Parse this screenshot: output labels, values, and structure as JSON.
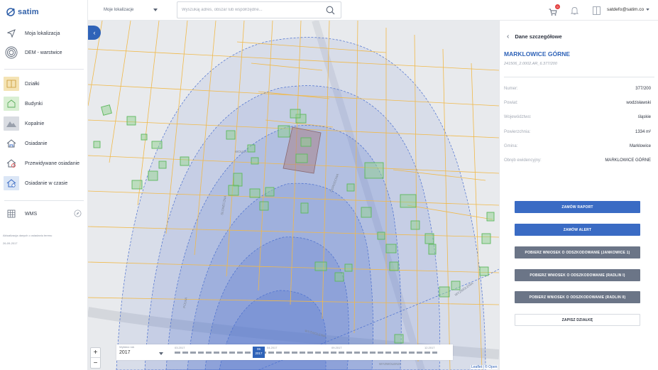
{
  "app": {
    "logo_text": "satim"
  },
  "sidebar": {
    "items": [
      {
        "label": "Moja lokalizacja",
        "icon": "location-arrow-icon"
      },
      {
        "label": "DEM - warstwice",
        "icon": "contour-rings-icon"
      },
      {
        "label": "Działki",
        "icon": "parcel-tile-icon",
        "color": "#f4e3b4"
      },
      {
        "label": "Budynki",
        "icon": "building-tile-icon",
        "color": "#d9efd3"
      },
      {
        "label": "Kopalnie",
        "icon": "mine-tile-icon",
        "color": "#d9dce2"
      },
      {
        "label": "Osiadanie",
        "icon": "house-subsidence-icon"
      },
      {
        "label": "Przewidywane osiadanie",
        "icon": "house-forecast-icon"
      },
      {
        "label": "Osiadanie w czasie",
        "icon": "house-time-icon",
        "color": "#dbe6f6"
      },
      {
        "label": "WMS",
        "icon": "wms-grid-icon"
      }
    ],
    "update_note": "Aktualizacja danych o osiadaniu terenu",
    "update_date": "26-09-2017"
  },
  "topbar": {
    "location_select": "Moje lokalizacje",
    "search_placeholder": "Wyszukaj adres, obszar lub współrzędne...",
    "cart_count": "0",
    "user_email": "satdefo@satim.co"
  },
  "map": {
    "timeline": {
      "year_label": "Wybierz rok",
      "year_value": "2017",
      "ticks": [
        "03.2017",
        "04.2017",
        "09.2017",
        "12.2017"
      ],
      "active_month": "06",
      "active_year": "2017"
    },
    "street_labels": [
      "WOLNA",
      "OGRODOWA",
      "SŁONECZNA",
      "WYZWOLENIA",
      "WYZWOLENIA",
      "WYZWOLENIA",
      "POLNA"
    ],
    "attribution": "Leaflet | © Open"
  },
  "panel": {
    "header": "Dane szczegółowe",
    "parcel_name": "MARKLOWICE GÓRNE",
    "parcel_id": "241506_2.0002.AR_6.377/200",
    "fields": [
      {
        "label": "Numer:",
        "value": "377/200"
      },
      {
        "label": "Powiat:",
        "value": "wodzisławski"
      },
      {
        "label": "Województwo:",
        "value": "śląskie"
      },
      {
        "label": "Powierzchnia:",
        "value": "1334 m²"
      },
      {
        "label": "Gmina:",
        "value": "Marklowice"
      },
      {
        "label": "Obręb ewidencyjny:",
        "value": "MARKLOWICE GÓRNE"
      }
    ],
    "buttons": [
      {
        "label": "ZAMÓW RAPORT",
        "style": "primary"
      },
      {
        "label": "ZAMÓW ALERT",
        "style": "primary"
      },
      {
        "label": "POBIERZ WNIOSEK O ODSZKODOWANIE (JANKOWICE 1)",
        "style": "gray"
      },
      {
        "label": "POBIERZ WNIOSEK O ODSZKODOWANIE (RADLIN I)",
        "style": "gray"
      },
      {
        "label": "POBIERZ WNIOSEK O ODSZKODOWANIE (RADLIN II)",
        "style": "gray"
      },
      {
        "label": "ZAPISZ DZIAŁKĘ",
        "style": "outline"
      }
    ]
  },
  "colors": {
    "brand": "#2f63b8",
    "parcel_lines": "#f0b94a",
    "buildings": "#5cb85c",
    "subsidence": "#4a6fcf"
  }
}
